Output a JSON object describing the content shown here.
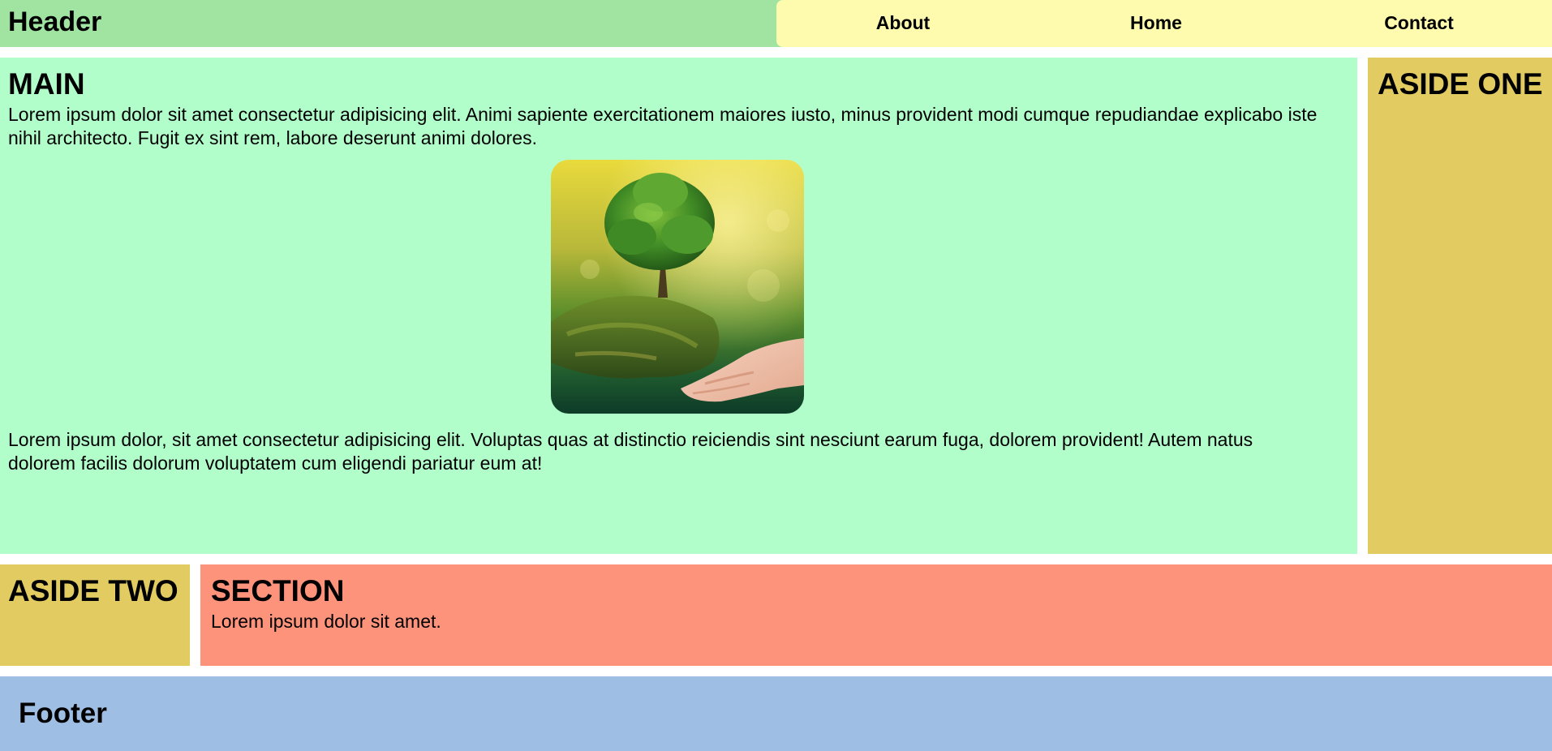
{
  "header": {
    "title": "Header",
    "nav": [
      {
        "label": "About"
      },
      {
        "label": "Home"
      },
      {
        "label": "Contact"
      }
    ]
  },
  "main": {
    "title": "MAIN",
    "paragraph_1": "Lorem ipsum dolor sit amet consectetur adipisicing elit. Animi sapiente exercitationem maiores iusto, minus provident modi cumque repudiandae explicabo iste nihil architecto. Fugit ex sint rem, labore deserunt animi dolores.",
    "image": "tree-in-hands-photo",
    "paragraph_2": "Lorem ipsum dolor, sit amet consectetur adipisicing elit. Voluptas quas at distinctio reiciendis sint nesciunt earum fuga, dolorem provident! Autem natus dolorem facilis dolorum voluptatem cum eligendi pariatur eum at!"
  },
  "aside_one": {
    "title": "ASIDE ONE"
  },
  "aside_two": {
    "title": "ASIDE TWO"
  },
  "section": {
    "title": "SECTION",
    "text": "Lorem ipsum dolor sit amet."
  },
  "footer": {
    "title": "Footer"
  },
  "colors": {
    "header_bg": "#a1e4a1",
    "nav_bg": "#fefbaf",
    "main_bg": "#b2fecb",
    "aside_bg": "#e2cb61",
    "section_bg": "#fe937c",
    "footer_bg": "#9ebee3"
  }
}
